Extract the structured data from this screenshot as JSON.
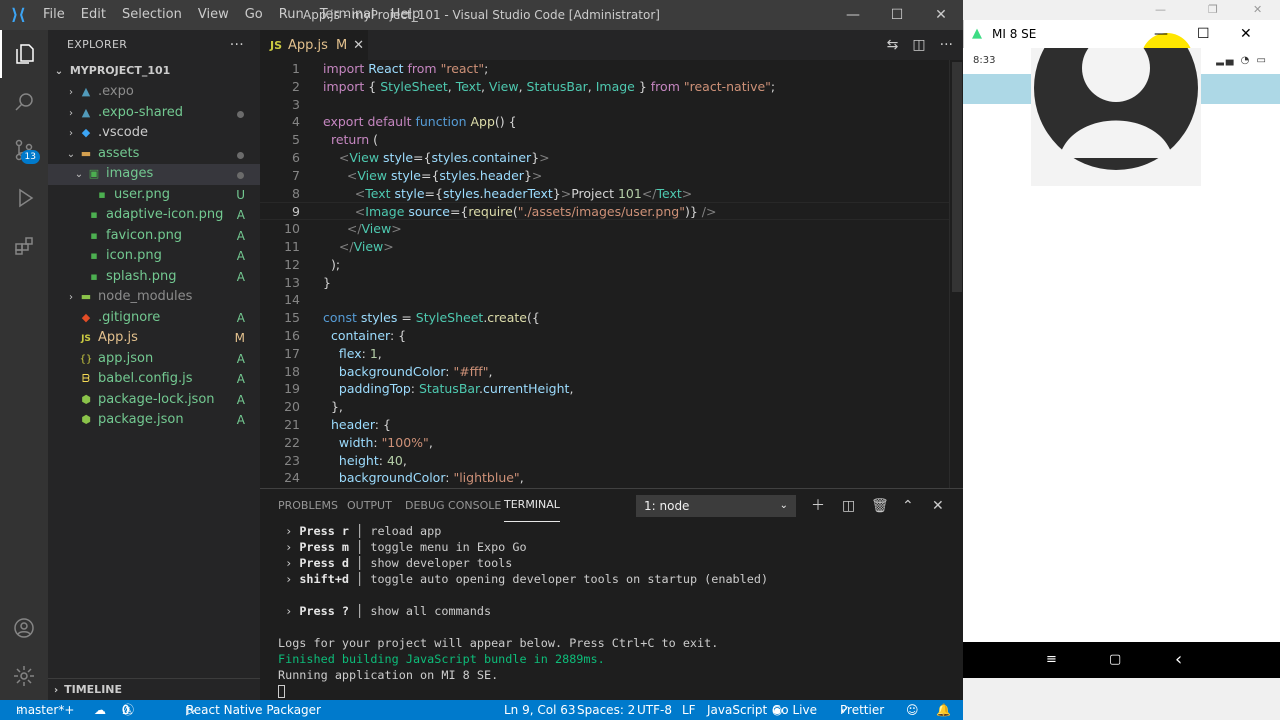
{
  "vscode": {
    "menu": [
      "File",
      "Edit",
      "Selection",
      "View",
      "Go",
      "Run",
      "Terminal",
      "Help"
    ],
    "window_title": "App.js - myProject_101 - Visual Studio Code [Administrator]",
    "window_controls": {
      "minimize": "—",
      "maximize": "☐",
      "close": "✕"
    },
    "activity_badge": "13",
    "explorer": {
      "header": "EXPLORER",
      "more": "···",
      "project": "MYPROJECT_101",
      "items": [
        {
          "label": ".expo",
          "status": ""
        },
        {
          "label": ".expo-shared",
          "status": ""
        },
        {
          "label": ".vscode",
          "status": ""
        },
        {
          "label": "assets",
          "status": ""
        },
        {
          "label": "images",
          "status": ""
        },
        {
          "label": "user.png",
          "status": "U"
        },
        {
          "label": "adaptive-icon.png",
          "status": "A"
        },
        {
          "label": "favicon.png",
          "status": "A"
        },
        {
          "label": "icon.png",
          "status": "A"
        },
        {
          "label": "splash.png",
          "status": "A"
        },
        {
          "label": "node_modules",
          "status": ""
        },
        {
          "label": ".gitignore",
          "status": "A"
        },
        {
          "label": "App.js",
          "status": "M"
        },
        {
          "label": "app.json",
          "status": "A"
        },
        {
          "label": "babel.config.js",
          "status": "A"
        },
        {
          "label": "package-lock.json",
          "status": "A"
        },
        {
          "label": "package.json",
          "status": "A"
        }
      ],
      "timeline": "TIMELINE"
    },
    "tab": {
      "label": "App.js",
      "modified": "M",
      "close": "✕",
      "lang_icon": "JS"
    },
    "code_lines": [
      "import React from \"react\";",
      "import { StyleSheet, Text, View, StatusBar, Image } from \"react-native\";",
      "",
      "export default function App() {",
      "  return (",
      "    <View style={styles.container}>",
      "      <View style={styles.header}>",
      "        <Text style={styles.headerText}>Project 101</Text>",
      "        <Image source={require(\"./assets/images/user.png\")} />",
      "      </View>",
      "    </View>",
      "  );",
      "}",
      "",
      "const styles = StyleSheet.create({",
      "  container: {",
      "    flex: 1,",
      "    backgroundColor: \"#fff\",",
      "    paddingTop: StatusBar.currentHeight,",
      "  },",
      "  header: {",
      "    width: \"100%\",",
      "    height: 40,",
      "    backgroundColor: \"lightblue\","
    ],
    "current_line": 9,
    "panel": {
      "tabs": [
        "PROBLEMS",
        "OUTPUT",
        "DEBUG CONSOLE",
        "TERMINAL"
      ],
      "active_tab": "TERMINAL",
      "terminal_select": "1: node",
      "terminal_lines": [
        {
          "key": "Press r",
          "desc": "reload app"
        },
        {
          "key": "Press m",
          "desc": "toggle menu in Expo Go"
        },
        {
          "key": "Press d",
          "desc": "show developer tools"
        },
        {
          "key": "shift+d",
          "desc": "toggle auto opening developer tools on startup (enabled)"
        },
        {
          "key": "Press ?",
          "desc": "show all commands"
        }
      ],
      "log1": "Logs for your project will appear below. Press Ctrl+C to exit.",
      "log2": "Finished building JavaScript bundle in 2889ms.",
      "log3": "Running application on MI 8 SE."
    },
    "statusbar": {
      "branch": "master*+",
      "errors": "0",
      "warnings": "0",
      "packager": "React Native Packager",
      "position": "Ln 9, Col 63",
      "spaces": "Spaces: 2",
      "encoding": "UTF-8",
      "eol": "LF",
      "language": "JavaScript",
      "golive": "Go Live",
      "prettier": "Prettier"
    }
  },
  "phone": {
    "device_name": "MI 8 SE",
    "time": "8:33",
    "nav": {
      "menu": "≡",
      "home": "▢",
      "back": "‹"
    }
  },
  "colors": {
    "accent": "#007acc",
    "header_bg": "#add8e6",
    "highlight": "#ffe600"
  }
}
